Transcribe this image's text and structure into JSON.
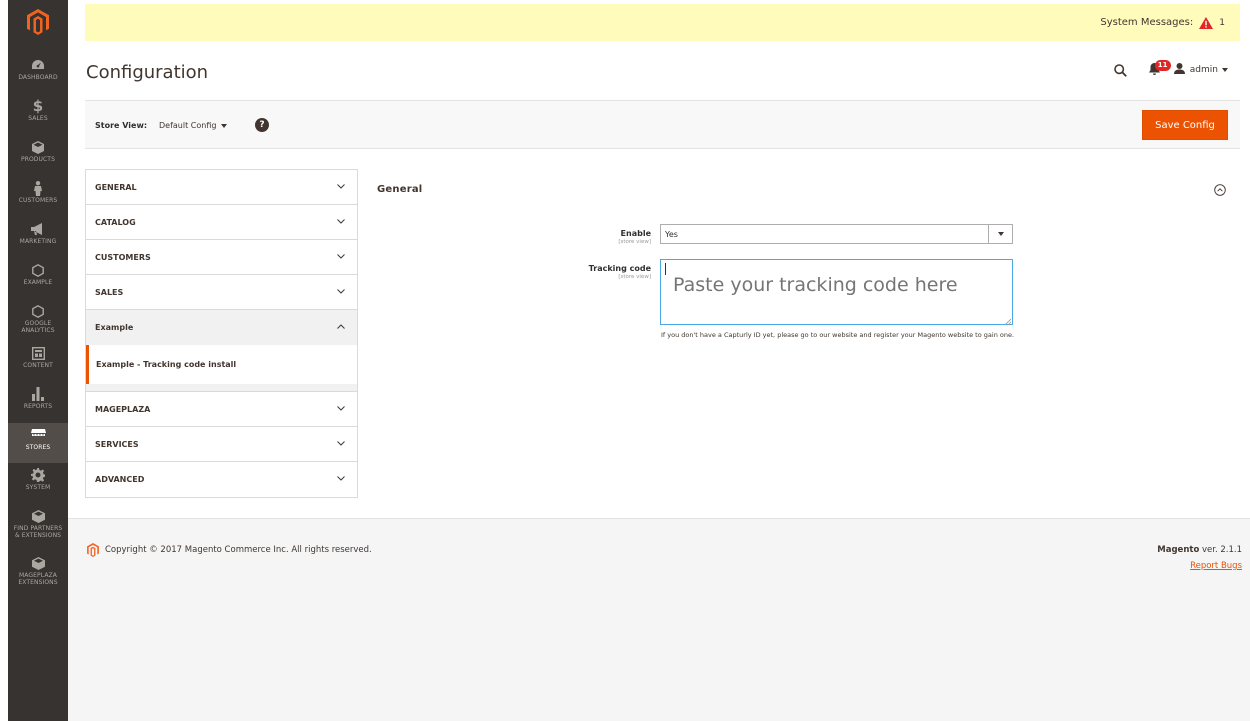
{
  "sidebar": {
    "logo_icon": "magento-logo-icon",
    "items": [
      {
        "label": "DASHBOARD",
        "icon": "dashboard-gauge-icon"
      },
      {
        "label": "SALES",
        "icon": "dollar-icon"
      },
      {
        "label": "PRODUCTS",
        "icon": "cube-icon"
      },
      {
        "label": "CUSTOMERS",
        "icon": "person-icon"
      },
      {
        "label": "MARKETING",
        "icon": "megaphone-icon"
      },
      {
        "label": "EXAMPLE",
        "icon": "hexagon-icon"
      },
      {
        "label": "GOOGLE\nANALYTICS",
        "icon": "hexagon-icon"
      },
      {
        "label": "CONTENT",
        "icon": "layout-icon"
      },
      {
        "label": "REPORTS",
        "icon": "bar-chart-icon"
      },
      {
        "label": "STORES",
        "icon": "store-icon",
        "active": true
      },
      {
        "label": "SYSTEM",
        "icon": "gear-icon"
      },
      {
        "label": "FIND PARTNERS\n& EXTENSIONS",
        "icon": "box-icon"
      },
      {
        "label": "MAGEPLAZA\nEXTENSIONS",
        "icon": "box-icon"
      }
    ]
  },
  "system_messages": {
    "label": "System Messages:",
    "count": "1",
    "icon": "warning-triangle-icon"
  },
  "header": {
    "title": "Configuration",
    "notifications_count": "11",
    "user": "admin"
  },
  "store_view": {
    "label": "Store View:",
    "value": "Default Config",
    "help": "?",
    "save_label": "Save Config"
  },
  "tabs": {
    "general": "GENERAL",
    "catalog": "CATALOG",
    "customers": "CUSTOMERS",
    "sales": "SALES",
    "example": "Example",
    "example_sub": "Example - Tracking code install",
    "mageplaza": "MAGEPLAZA",
    "services": "SERVICES",
    "advanced": "ADVANCED"
  },
  "section": {
    "title": "General",
    "enable_label": "Enable",
    "enable_scope": "[store view]",
    "enable_value": "Yes",
    "tracking_label": "Tracking code",
    "tracking_scope": "[store view]",
    "tracking_placeholder": "Paste your tracking code here",
    "note": "If you don't have a Capturly ID yet, please go to our website and register your Magento website to gain one."
  },
  "footer": {
    "copyright": "Copyright © 2017 Magento Commerce Inc. All rights reserved.",
    "brand": "Magento",
    "version": " ver. 2.1.1",
    "report_bugs": "Report Bugs"
  },
  "colors": {
    "accent": "#eb5202",
    "sidebar": "#373330",
    "sysbar": "#fffbbb"
  }
}
